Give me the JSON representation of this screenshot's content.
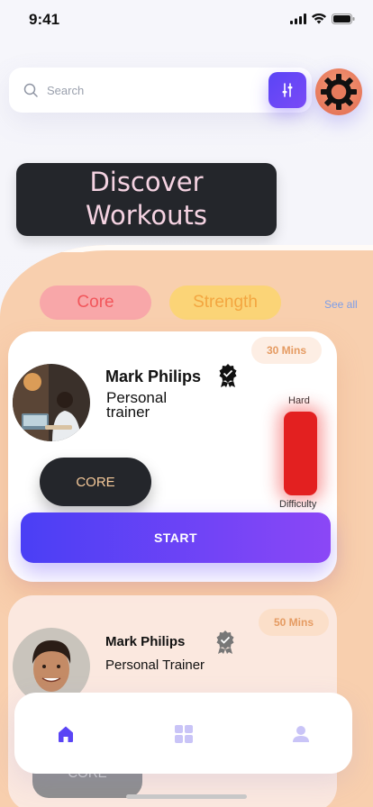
{
  "status_bar": {
    "time": "9:41"
  },
  "search": {
    "placeholder": "Search"
  },
  "heading": {
    "line1": "Discover",
    "line2": "Workouts"
  },
  "categories": {
    "items": [
      {
        "label": "Core",
        "color": "#f2565b"
      },
      {
        "label": "Strength",
        "color": "#f3a640"
      }
    ],
    "see_all": "See all"
  },
  "workouts": [
    {
      "duration": "30 Mins",
      "trainer_name": "Mark Philips",
      "trainer_role_line1": "Personal",
      "trainer_role_line2": "trainer",
      "tag": "CORE",
      "difficulty_top": "Hard",
      "difficulty_bottom": "Difficulty",
      "start_label": "START"
    },
    {
      "duration": "50 Mins",
      "trainer_name": "Mark Philips",
      "trainer_role": "Personal Trainer",
      "tag": "CORE"
    }
  ],
  "nav": {
    "items": [
      {
        "icon": "home-icon",
        "active": true
      },
      {
        "icon": "grid-icon",
        "active": false
      },
      {
        "icon": "profile-icon",
        "active": false
      }
    ]
  },
  "colors": {
    "accent": "#5a45f5",
    "sheet": "#f8cfae",
    "difficulty": "#e32020",
    "dark_chip": "#24262b"
  }
}
